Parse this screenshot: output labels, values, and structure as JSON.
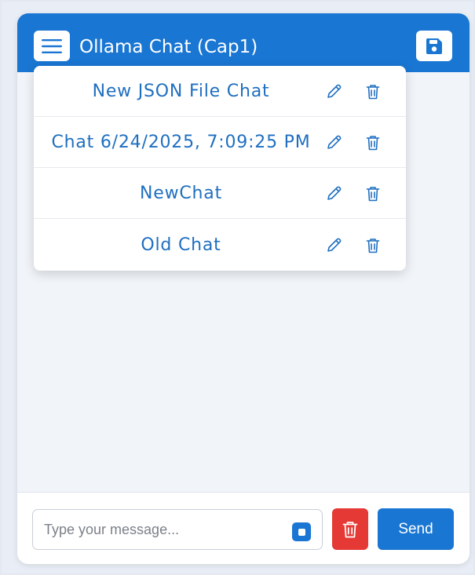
{
  "header": {
    "title": "Ollama Chat (Cap1)",
    "menu_icon": "hamburger-menu-icon",
    "save_icon": "floppy-disk-save-icon"
  },
  "chat_list": {
    "items": [
      {
        "label": "New JSON File Chat"
      },
      {
        "label": "Chat 6/24/2025, 7:09:25 PM"
      },
      {
        "label": "NewChat"
      },
      {
        "label": "Old Chat"
      }
    ],
    "edit_icon": "pencil-icon",
    "delete_icon": "trash-icon"
  },
  "composer": {
    "placeholder": "Type your message...",
    "value": "",
    "stop_icon": "stop-square-icon",
    "clear_icon": "trash-icon",
    "send_label": "Send"
  },
  "colors": {
    "primary": "#1976d2",
    "danger": "#e53935",
    "background": "#f1f4f9"
  }
}
